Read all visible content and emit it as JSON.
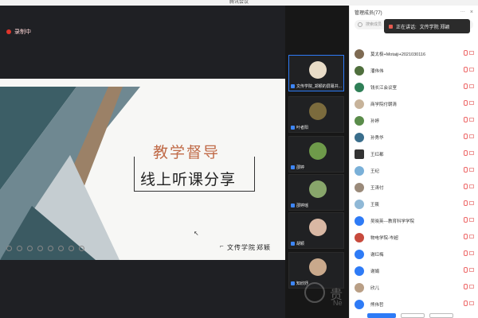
{
  "window": {
    "title": "腾讯会议"
  },
  "stage": {
    "recording_label": "录制中",
    "slide": {
      "title_line1": "教学督导",
      "title_line2": "线上听课分享",
      "author_org": "文传学院",
      "author_name": "郑颖"
    }
  },
  "filmstrip": [
    {
      "name": "文传学院_郑颖的屏幕共...",
      "active": true
    },
    {
      "name": "叶者阳",
      "active": false
    },
    {
      "name": "邵婷",
      "active": false
    },
    {
      "name": "邵婷瑶",
      "active": false
    },
    {
      "name": "胡颖",
      "active": false
    },
    {
      "name": "知欣妤",
      "active": false
    }
  ],
  "sidebar": {
    "title": "管理成员(77)",
    "search_placeholder": "搜索成员",
    "speaking_prefix": "正在讲话:",
    "speaking_name": "文传学院 郑颖",
    "members": [
      "莫太极+Motaiji+2021030116",
      "潘伟伟",
      "钱长江会议室",
      "商学院付朝清",
      "孙婷",
      "孙秀华",
      "王红都",
      "王纪",
      "王涛付",
      "王筱",
      "吴晓英---教育科学学院",
      "物电学院-岑超",
      "谢红梅",
      "谢娟",
      "欣儿",
      "熊伟哲"
    ]
  },
  "watermark": {
    "glyph": "贵",
    "text": "Ne"
  }
}
